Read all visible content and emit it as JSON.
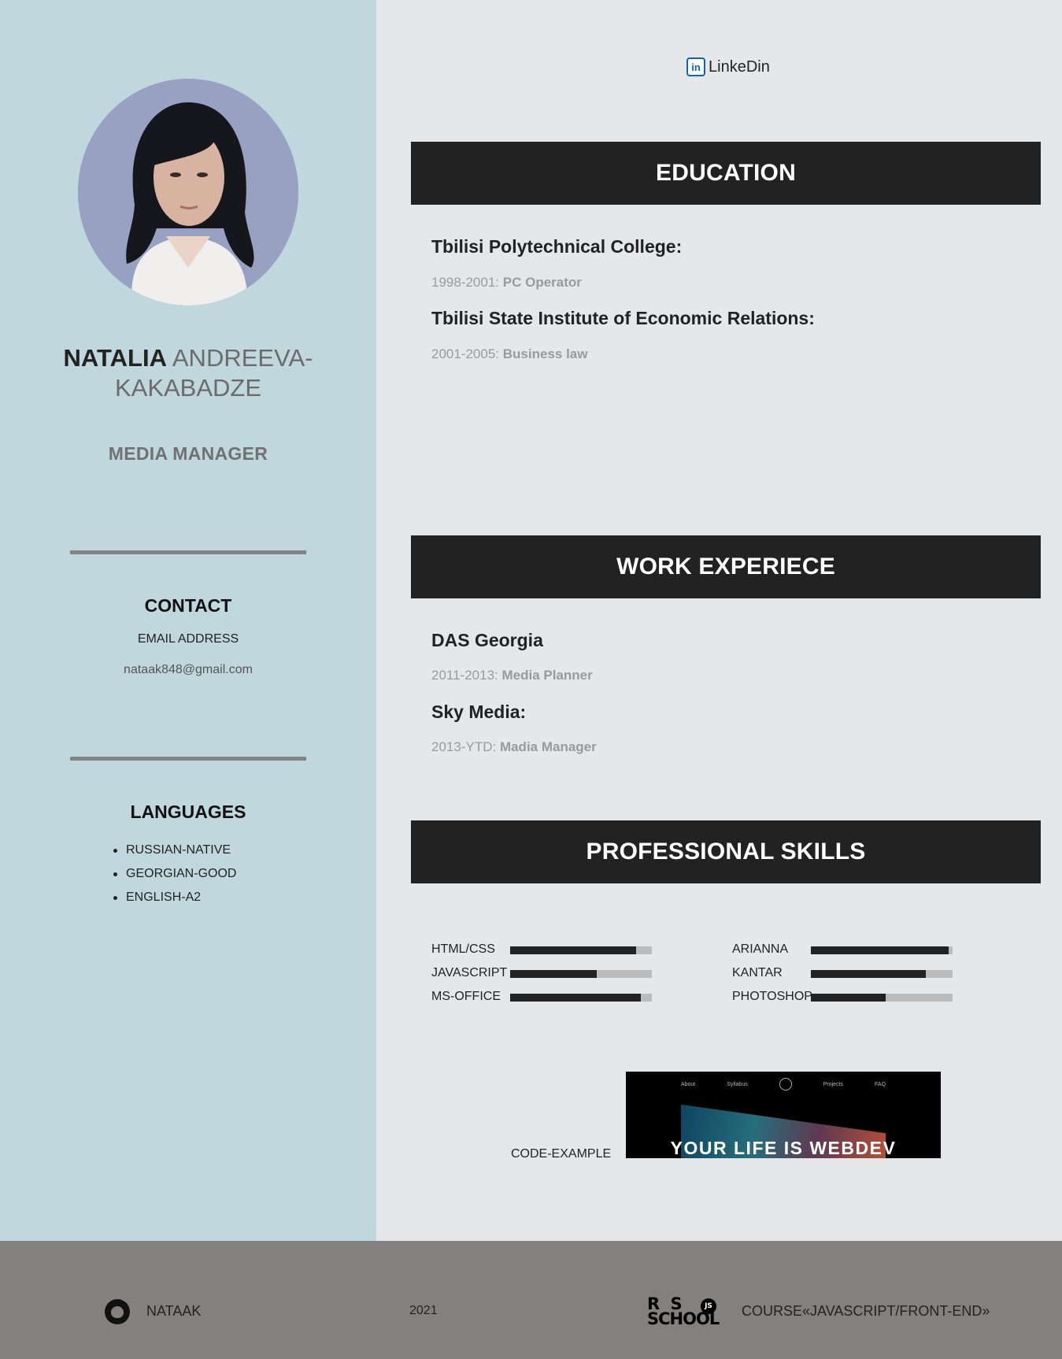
{
  "profile": {
    "first_name": "NATALIA",
    "last_name": "ANDREEVA-KAKABADZE",
    "role": "MEDIA MANAGER"
  },
  "contact": {
    "title": "CONTACT",
    "email_label": "EMAIL ADDRESS",
    "email": "nataak848@gmail.com"
  },
  "languages": {
    "title": "LANGUAGES",
    "items": [
      "RUSSIAN-NATIVE",
      "GEORGIAN-GOOD",
      "ENGLISH-A2"
    ]
  },
  "linkedin": {
    "icon": "in",
    "label": "LinkeDin"
  },
  "education": {
    "title": "EDUCATION",
    "entries": [
      {
        "school": "Tbilisi Polytechnical College:",
        "years": "1998-2001:",
        "degree": "PC Operator"
      },
      {
        "school": "Tbilisi State Institute of Economic Relations:",
        "years": "2001-2005:",
        "degree": "Business law"
      }
    ]
  },
  "work": {
    "title": "WORK EXPERIECE",
    "entries": [
      {
        "company": "DAS Georgia",
        "years": "2011-2013:",
        "position": "Media Planner"
      },
      {
        "company": "Sky Media:",
        "years": "2013-YTD:",
        "position": "Madia Manager"
      }
    ]
  },
  "skills": {
    "title": "PROFESSIONAL SKILLS",
    "left": [
      {
        "name": "HTML/CSS",
        "level": 0.89
      },
      {
        "name": "JAVASCRIPT",
        "level": 0.61
      },
      {
        "name": "MS-OFFICE",
        "level": 0.92
      }
    ],
    "right": [
      {
        "name": "ARIANNA",
        "level": 0.97
      },
      {
        "name": "KANTAR",
        "level": 0.81
      },
      {
        "name": "PHOTOSHOP",
        "level": 0.53
      }
    ]
  },
  "code_example": {
    "label": "CODE-EXAMPLE",
    "nav": [
      "About",
      "Syllabus",
      "Projects",
      "FAQ"
    ],
    "headline": "YOUR LIFE IS WEBDEV"
  },
  "footer": {
    "github_user": "NATAAK",
    "year": "2021",
    "logo_top": "R S",
    "logo_bottom": "SCHOOL",
    "logo_badge": "JS",
    "course": "COURSE«JAVASCRIPT/FRONT-END»"
  },
  "colors": {
    "sidebar": "#c0d7de",
    "main_bg": "#e6e7e9",
    "header_bg": "#222222",
    "footer_bg": "#858080",
    "linkedin": "#0a66c2"
  }
}
